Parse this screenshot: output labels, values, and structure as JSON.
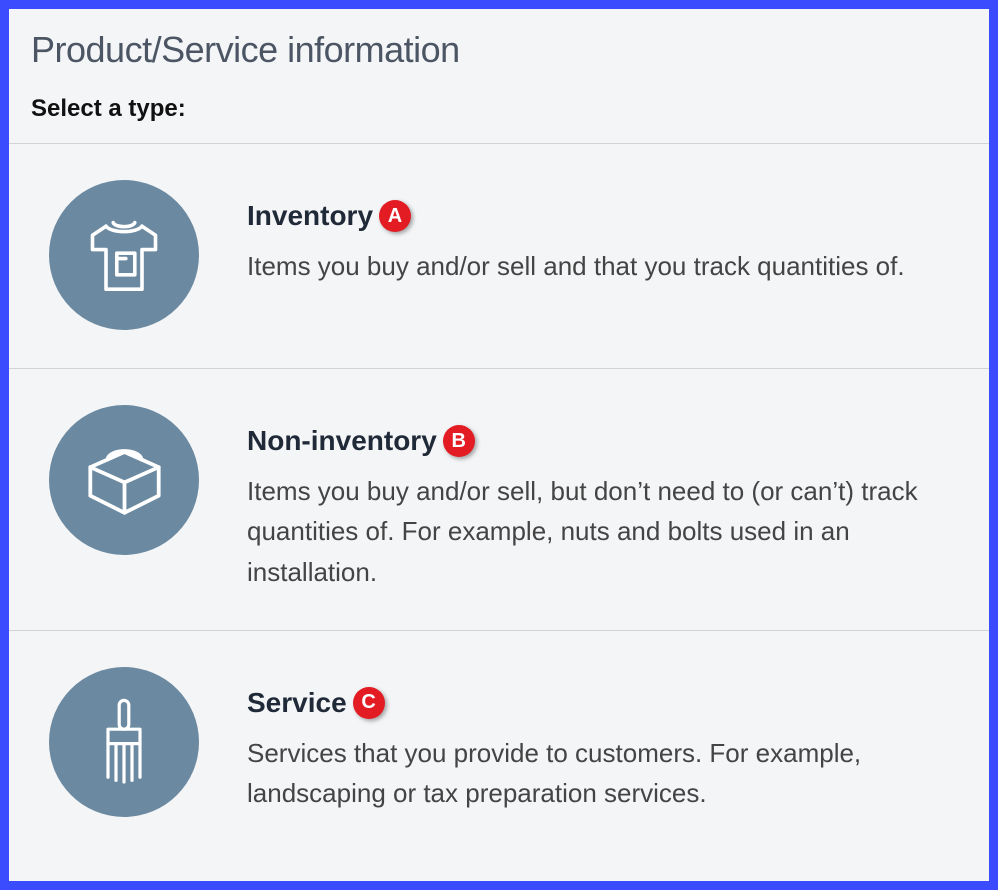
{
  "panel": {
    "title": "Product/Service information",
    "subtitle": "Select a type:"
  },
  "options": [
    {
      "label": "Inventory",
      "badge": "A",
      "description": "Items you buy and/or sell and that you track quantities of."
    },
    {
      "label": "Non-inventory",
      "badge": "B",
      "description": "Items you buy and/or sell, but don’t need to (or can’t) track quantities of. For example, nuts and bolts used in an installation."
    },
    {
      "label": "Service",
      "badge": "C",
      "description": "Services that you provide to customers. For example, landscaping or tax preparation services."
    }
  ],
  "colors": {
    "accent": "#3b4cff",
    "iconCircle": "#6b89a0",
    "badge": "#e31b23"
  }
}
